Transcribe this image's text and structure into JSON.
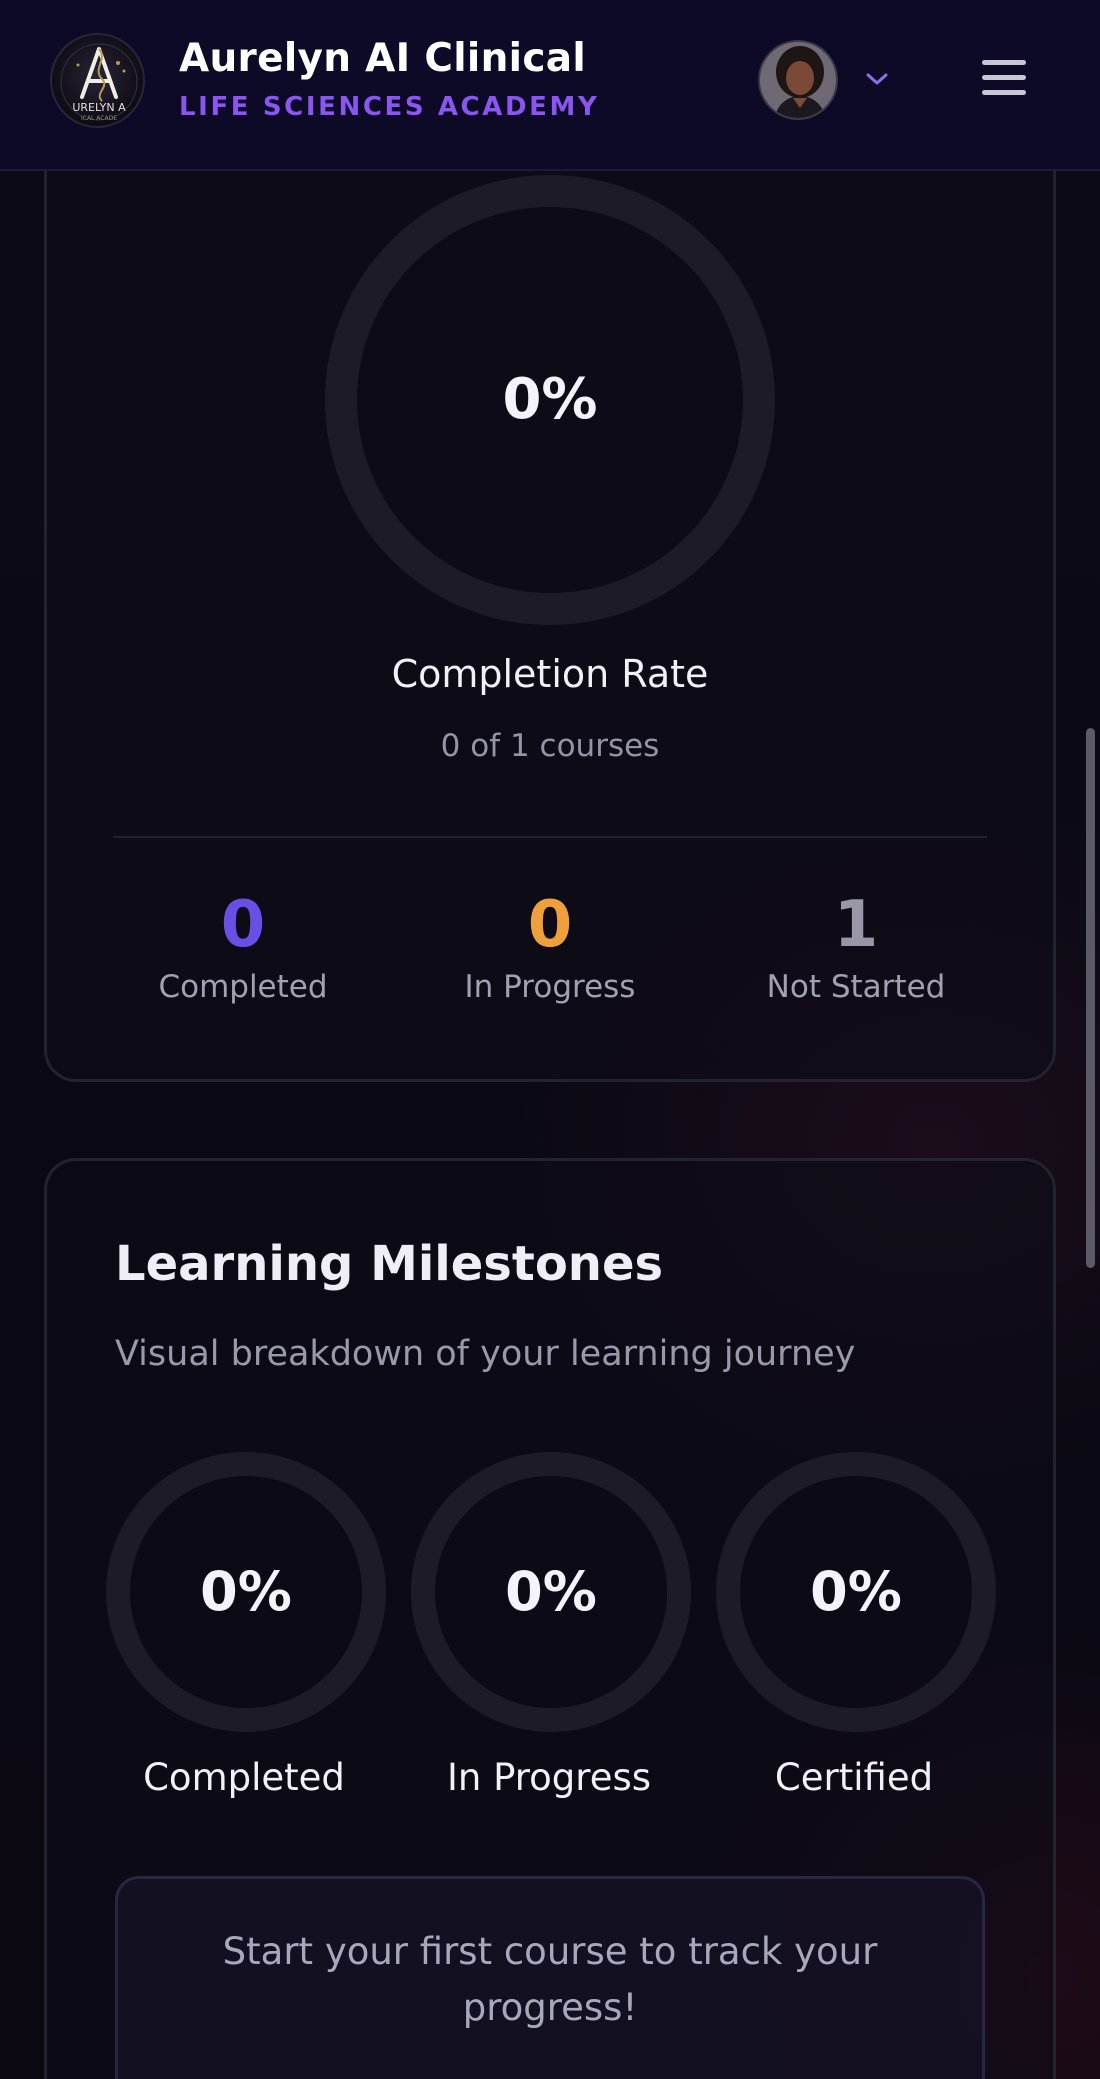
{
  "header": {
    "title": "Aurelyn AI Clinical",
    "subtitle": "LIFE SCIENCES ACADEMY",
    "logo_icon": "aurelyn-logo",
    "avatar_icon": "user-avatar",
    "dropdown_icon": "chevron-down-icon",
    "menu_icon": "hamburger-menu-icon",
    "accent_color": "#8a55f0"
  },
  "progress_card": {
    "completion_percent": "0%",
    "completion_value": 0,
    "completion_label": "Completion Rate",
    "courses_text": "0 of 1 courses",
    "stats": [
      {
        "value": "0",
        "label": "Completed",
        "color": "#6a4ee6"
      },
      {
        "value": "0",
        "label": "In Progress",
        "color": "#f0a03a"
      },
      {
        "value": "1",
        "label": "Not Started",
        "color": "#9896a8"
      }
    ]
  },
  "milestones": {
    "title": "Learning Milestones",
    "subtitle": "Visual breakdown of your learning journey",
    "rings": [
      {
        "value": "0%",
        "label": "Completed"
      },
      {
        "value": "0%",
        "label": "In Progress"
      },
      {
        "value": "0%",
        "label": "Certified"
      }
    ],
    "cta": "Start your first course to track your progress!"
  }
}
